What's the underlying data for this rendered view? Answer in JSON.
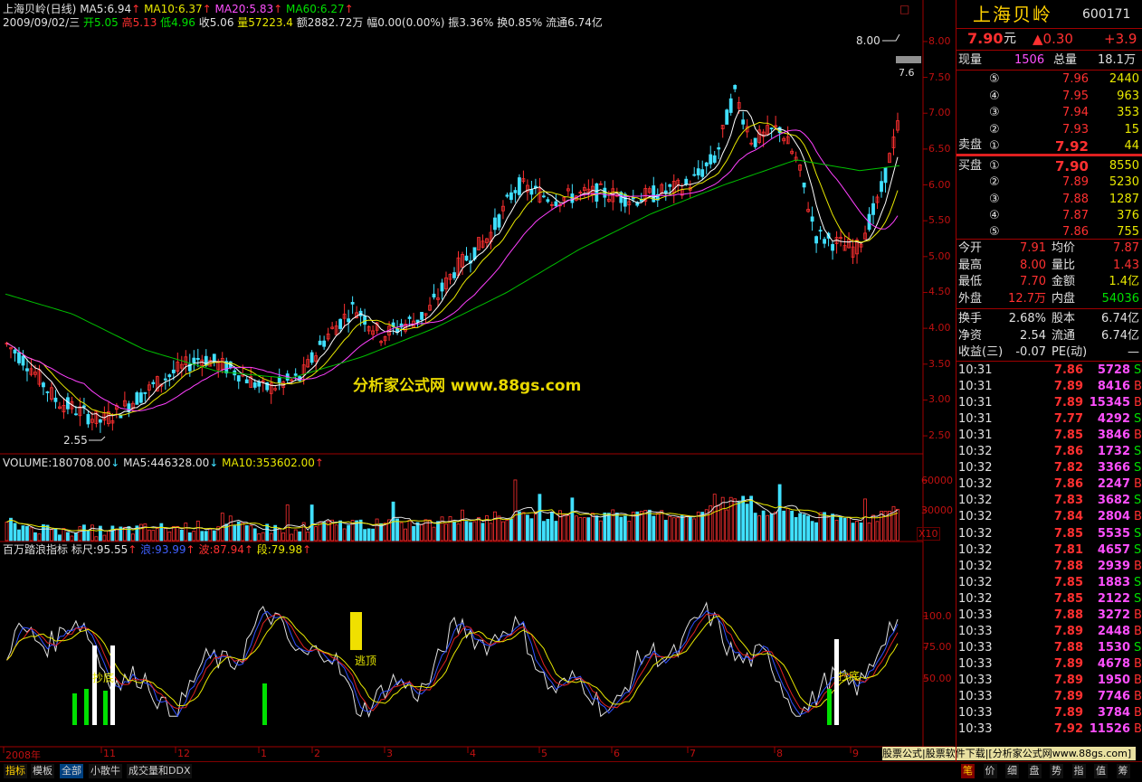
{
  "header": {
    "line1": {
      "name": "上海贝岭(日线)",
      "ma5": "MA5:6.94",
      "ma10": "MA10:6.37",
      "ma20": "MA20:5.83",
      "ma60": "MA60:6.27",
      "arrow_up": "↑"
    },
    "line2": {
      "date": "2009/09/02/三",
      "open": "开5.05",
      "high": "高5.13",
      "low": "低4.96",
      "close": "收5.06",
      "vol": "量57223.4",
      "amount": "额2882.72万",
      "change": "幅0.00(0.00%)",
      "amplitude": "振3.36%",
      "turnover": "换0.85%",
      "float": "流通6.74亿"
    },
    "close_box": "□"
  },
  "price_chart": {
    "yticks": [
      "8.00",
      "7.50",
      "7.00",
      "6.50",
      "6.00",
      "5.50",
      "5.00",
      "4.50",
      "4.00",
      "3.50",
      "3.00",
      "2.50"
    ],
    "high_marker": "8.00",
    "low_marker": "2.55",
    "right_marker": "7.6",
    "watermark": "分析家公式网 www.88gs.com"
  },
  "volume_chart": {
    "label": "VOLUME:180708.00",
    "ma5": "MA5:446328.00",
    "ma10": "MA10:353602.00",
    "yticks": [
      "60000",
      "30000"
    ],
    "unit": "X10"
  },
  "indicator_chart": {
    "name": "百万踏浪指标",
    "biao": "标尺:95.55",
    "lang": "浪:93.99",
    "bo": "波:87.94",
    "duan": "段:79.98",
    "yticks": [
      "100.0",
      "75.00",
      "50.00"
    ],
    "marks": [
      "抄底",
      "逃顶",
      "抄底"
    ]
  },
  "time_axis": [
    "2008年",
    "11",
    "12",
    "1",
    "2",
    "3",
    "4",
    "5",
    "6",
    "7",
    "8",
    "9"
  ],
  "right_panel": {
    "title": "上海贝岭",
    "code": "600171",
    "price": "7.90",
    "price_unit": "元",
    "change": "▲0.30",
    "change_pct": "+3.9",
    "xianliang_lbl": "现量",
    "xianliang": "1506",
    "zongliang_lbl": "总量",
    "zongliang": "18.1万",
    "sell": [
      {
        "lbl": "⑤",
        "price": "7.96",
        "vol": "2440"
      },
      {
        "lbl": "④",
        "price": "7.95",
        "vol": "963"
      },
      {
        "lbl": "③",
        "price": "7.94",
        "vol": "353"
      },
      {
        "lbl": "②",
        "price": "7.93",
        "vol": "15"
      },
      {
        "lbl": "①",
        "price": "7.92",
        "vol": "44"
      }
    ],
    "sell_lbl": "卖盘",
    "buy_lbl": "买盘",
    "buy": [
      {
        "lbl": "①",
        "price": "7.90",
        "vol": "8550"
      },
      {
        "lbl": "②",
        "price": "7.89",
        "vol": "5230"
      },
      {
        "lbl": "③",
        "price": "7.88",
        "vol": "1287"
      },
      {
        "lbl": "④",
        "price": "7.87",
        "vol": "376"
      },
      {
        "lbl": "⑤",
        "price": "7.86",
        "vol": "755"
      }
    ],
    "stats": [
      {
        "l1": "今开",
        "v1": "7.91",
        "l2": "均价",
        "v2": "7.87"
      },
      {
        "l1": "最高",
        "v1": "8.00",
        "l2": "量比",
        "v2": "1.43"
      },
      {
        "l1": "最低",
        "v1": "7.70",
        "l2": "金额",
        "v2": "1.4亿"
      },
      {
        "l1": "外盘",
        "v1": "12.7万",
        "l2": "内盘",
        "v2": "54036"
      }
    ],
    "stats2": [
      {
        "l1": "换手",
        "v1": "2.68%",
        "l2": "股本",
        "v2": "6.74亿"
      },
      {
        "l1": "净资",
        "v1": "2.54",
        "l2": "流通",
        "v2": "6.74亿"
      },
      {
        "l1": "收益(三)",
        "v1": "-0.07",
        "l2": "PE(动)",
        "v2": "—"
      }
    ],
    "ticks": [
      {
        "t": "10:31",
        "p": "7.86",
        "v": "5728",
        "s": "S"
      },
      {
        "t": "10:31",
        "p": "7.89",
        "v": "8416",
        "s": "B"
      },
      {
        "t": "10:31",
        "p": "7.89",
        "v": "15345",
        "s": "B"
      },
      {
        "t": "10:31",
        "p": "7.77",
        "v": "4292",
        "s": "S"
      },
      {
        "t": "10:31",
        "p": "7.85",
        "v": "3846",
        "s": "B"
      },
      {
        "t": "10:32",
        "p": "7.86",
        "v": "1732",
        "s": "S"
      },
      {
        "t": "10:32",
        "p": "7.82",
        "v": "3366",
        "s": "S"
      },
      {
        "t": "10:32",
        "p": "7.86",
        "v": "2247",
        "s": "B"
      },
      {
        "t": "10:32",
        "p": "7.83",
        "v": "3682",
        "s": "S"
      },
      {
        "t": "10:32",
        "p": "7.84",
        "v": "2804",
        "s": "B"
      },
      {
        "t": "10:32",
        "p": "7.85",
        "v": "5535",
        "s": "S"
      },
      {
        "t": "10:32",
        "p": "7.81",
        "v": "4657",
        "s": "S"
      },
      {
        "t": "10:32",
        "p": "7.88",
        "v": "2939",
        "s": "B"
      },
      {
        "t": "10:32",
        "p": "7.85",
        "v": "1883",
        "s": "S"
      },
      {
        "t": "10:32",
        "p": "7.85",
        "v": "2122",
        "s": "S"
      },
      {
        "t": "10:33",
        "p": "7.88",
        "v": "3272",
        "s": "B"
      },
      {
        "t": "10:33",
        "p": "7.89",
        "v": "2448",
        "s": "B"
      },
      {
        "t": "10:33",
        "p": "7.88",
        "v": "1530",
        "s": "S"
      },
      {
        "t": "10:33",
        "p": "7.89",
        "v": "4678",
        "s": "B"
      },
      {
        "t": "10:33",
        "p": "7.89",
        "v": "1950",
        "s": "B"
      },
      {
        "t": "10:33",
        "p": "7.89",
        "v": "7746",
        "s": "B"
      },
      {
        "t": "10:33",
        "p": "7.89",
        "v": "3784",
        "s": "B"
      },
      {
        "t": "10:33",
        "p": "7.92",
        "v": "11526",
        "s": "B"
      }
    ]
  },
  "status_text": "股票公式|股票软件下载|[分析家公式网www.88gs.com]",
  "bottom_tabs": [
    "指标",
    "模板",
    "全部",
    "小散牛",
    "成交量和DDX"
  ],
  "bottom_right_tabs": [
    "笔",
    "价",
    "细",
    "盘",
    "势",
    "指",
    "值",
    "筹"
  ],
  "colors": {
    "up": "#ff3030",
    "down": "#40e0ff",
    "ma5": "#ffffff",
    "ma10": "#e8e800",
    "ma20": "#ff40ff",
    "ma60": "#00c000",
    "axis": "#a00000"
  }
}
